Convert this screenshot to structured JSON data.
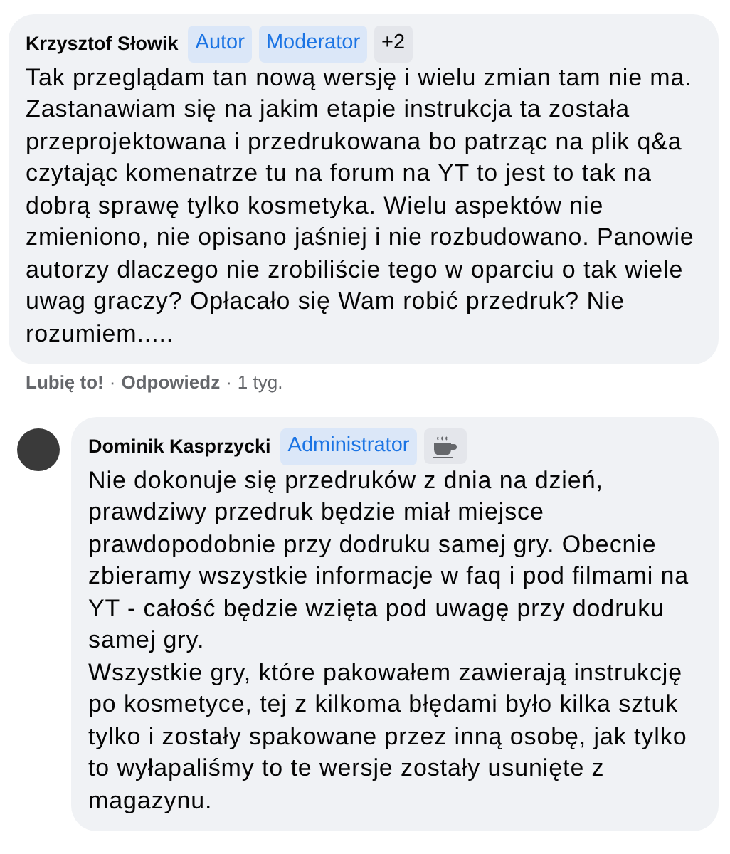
{
  "comments": [
    {
      "author": "Krzysztof Słowik",
      "has_avatar": false,
      "badges": [
        {
          "kind": "role",
          "label": "Autor"
        },
        {
          "kind": "role",
          "label": "Moderator"
        },
        {
          "kind": "count",
          "label": "+2"
        }
      ],
      "paragraphs": [
        "Tak przeglądam tan nową wersję i wielu zmian tam nie ma. Zastanawiam się na jakim etapie instrukcja ta została przeprojektowana i przedrukowana bo patrząc na plik q&a czytając komenatrze tu na forum na YT to jest to tak na dobrą sprawę tylko kosmetyka. Wielu aspektów nie zmieniono, nie opisano jaśniej i nie rozbudowano. Panowie autorzy dlaczego nie zrobiliście tego w oparciu o tak wiele uwag graczy? Opłacało się Wam robić przedruk? Nie rozumiem....."
      ],
      "actions": [
        {
          "label": "Lubię to!"
        },
        {
          "label": "Odpowiedz"
        }
      ],
      "separator": "·",
      "time": "1 tyg."
    },
    {
      "author": "Dominik Kasprzycki",
      "has_avatar": true,
      "badges": [
        {
          "kind": "role",
          "label": "Administrator"
        },
        {
          "kind": "icon"
        }
      ],
      "paragraphs": [
        "Nie dokonuje się przedruków z dnia na dzień, prawdziwy przedruk będzie miał miejsce prawdopodobnie przy dodruku samej gry. Obecnie zbieramy wszystkie informacje w faq i pod filmami na YT - całość będzie wzięta pod uwagę przy dodruku samej gry.",
        "Wszystkie gry, które pakowałem zawierają instrukcję po kosmetyce, tej z kilkoma błędami było kilka sztuk tylko i zostały spakowane przez inną osobę, jak tylko to wyłapaliśmy to te wersje zostały usunięte z magazynu."
      ]
    }
  ]
}
